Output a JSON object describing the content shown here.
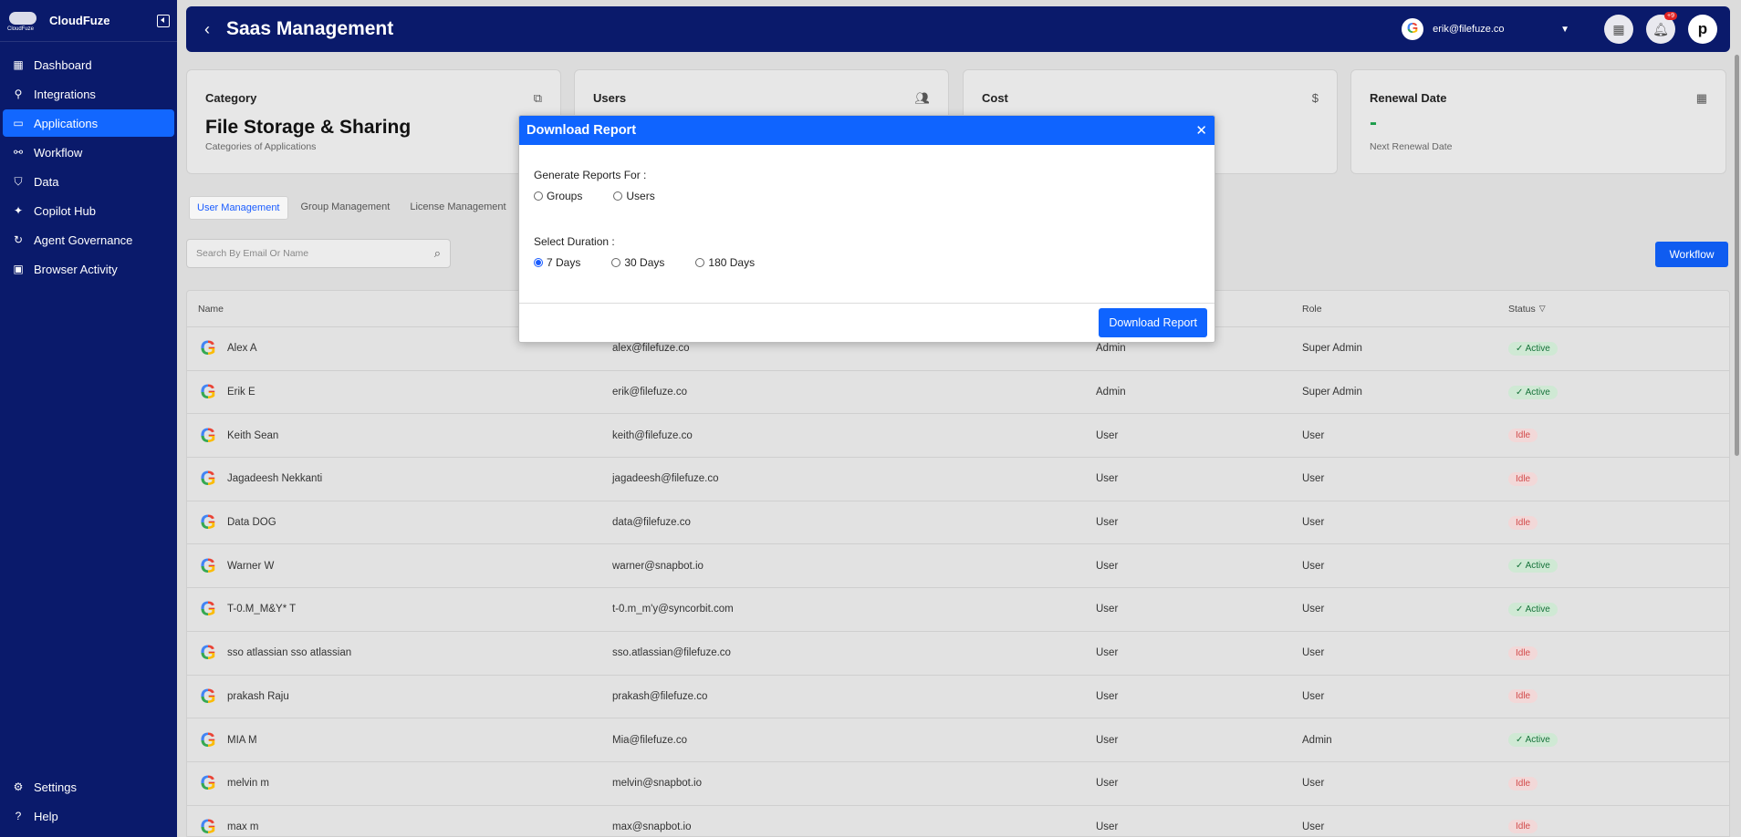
{
  "sidebar": {
    "brand": "CloudFuze",
    "brand_sub": "CloudFuze",
    "items": [
      {
        "label": "Dashboard",
        "icon": "dashboard-icon"
      },
      {
        "label": "Integrations",
        "icon": "integrations-icon"
      },
      {
        "label": "Applications",
        "icon": "applications-icon",
        "active": true
      },
      {
        "label": "Workflow",
        "icon": "workflow-icon"
      },
      {
        "label": "Data",
        "icon": "shield-icon"
      },
      {
        "label": "Copilot Hub",
        "icon": "sparkle-icon"
      },
      {
        "label": "Agent Governance",
        "icon": "refresh-icon"
      },
      {
        "label": "Browser Activity",
        "icon": "monitor-icon"
      }
    ],
    "bottom": [
      {
        "label": "Settings",
        "icon": "gear-icon"
      },
      {
        "label": "Help",
        "icon": "help-icon"
      }
    ]
  },
  "header": {
    "title": "Saas Management",
    "account_email": "erik@filefuze.co",
    "notification_badge": "+9",
    "avatar_letter": "p"
  },
  "cards": {
    "category": {
      "title": "Category",
      "value": "File Storage & Sharing",
      "sub": "Categories of Applications"
    },
    "users": {
      "title": "Users"
    },
    "cost": {
      "title": "Cost"
    },
    "renewal": {
      "title": "Renewal Date",
      "value": "-",
      "sub": "Next Renewal Date"
    }
  },
  "tabs": [
    "User Management",
    "Group Management",
    "License Management"
  ],
  "search": {
    "placeholder": "Search By Email Or Name"
  },
  "workflow_button": "Workflow",
  "table": {
    "columns": {
      "name": "Name",
      "role": "Role",
      "status": "Status"
    },
    "rows": [
      {
        "name": "Alex A",
        "email": "alex@filefuze.co",
        "type": "Admin",
        "role": "Super Admin",
        "status": "Active"
      },
      {
        "name": "Erik E",
        "email": "erik@filefuze.co",
        "type": "Admin",
        "role": "Super Admin",
        "status": "Active"
      },
      {
        "name": "Keith Sean",
        "email": "keith@filefuze.co",
        "type": "User",
        "role": "User",
        "status": "Idle"
      },
      {
        "name": "Jagadeesh Nekkanti",
        "email": "jagadeesh@filefuze.co",
        "type": "User",
        "role": "User",
        "status": "Idle"
      },
      {
        "name": "Data DOG",
        "email": "data@filefuze.co",
        "type": "User",
        "role": "User",
        "status": "Idle"
      },
      {
        "name": "Warner W",
        "email": "warner@snapbot.io",
        "type": "User",
        "role": "User",
        "status": "Active"
      },
      {
        "name": "T-0.M_M&Y* T",
        "email": "t-0.m_m'y@syncorbit.com",
        "type": "User",
        "role": "User",
        "status": "Active"
      },
      {
        "name": "sso atlassian sso atlassian",
        "email": "sso.atlassian@filefuze.co",
        "type": "User",
        "role": "User",
        "status": "Idle"
      },
      {
        "name": "prakash Raju",
        "email": "prakash@filefuze.co",
        "type": "User",
        "role": "User",
        "status": "Idle"
      },
      {
        "name": "MIA M",
        "email": "Mia@filefuze.co",
        "type": "User",
        "role": "Admin",
        "status": "Active"
      },
      {
        "name": "melvin m",
        "email": "melvin@snapbot.io",
        "type": "User",
        "role": "User",
        "status": "Idle"
      },
      {
        "name": "max m",
        "email": "max@snapbot.io",
        "type": "User",
        "role": "User",
        "status": "Idle"
      }
    ]
  },
  "modal": {
    "title": "Download Report",
    "generate_label": "Generate Reports For :",
    "generate_options": [
      {
        "label": "Groups",
        "checked": false
      },
      {
        "label": "Users",
        "checked": false
      }
    ],
    "duration_label": "Select Duration :",
    "duration_options": [
      {
        "label": "7 Days",
        "checked": true
      },
      {
        "label": "30 Days",
        "checked": false
      },
      {
        "label": "180 Days",
        "checked": false
      }
    ],
    "download_button": "Download Report"
  },
  "colors": {
    "sidebar_bg": "#0a1a6b",
    "accent": "#0f64ff",
    "active_status": "#16723a",
    "idle_status": "#d24a4a"
  }
}
